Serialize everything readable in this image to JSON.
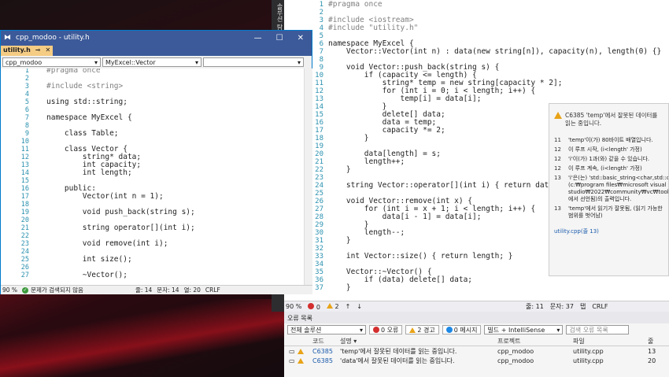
{
  "back_editor": {
    "side_tab": "솔루션 탐색기",
    "lines": [
      {
        "n": "1",
        "t": "#pragma once"
      },
      {
        "n": "2",
        "t": ""
      },
      {
        "n": "3",
        "t": "#include <iostream>"
      },
      {
        "n": "4",
        "t": "#include \"utility.h\""
      },
      {
        "n": "5",
        "t": ""
      },
      {
        "n": "6",
        "t": "namespace MyExcel {"
      },
      {
        "n": "7",
        "t": "    Vector::Vector(int n) : data(new string[n]), capacity(n), length(0) {}"
      },
      {
        "n": "8",
        "t": ""
      },
      {
        "n": "9",
        "t": "    void Vector::push_back(string s) {"
      },
      {
        "n": "10",
        "t": "        if (capacity <= length) {"
      },
      {
        "n": "11",
        "t": "            string* temp = new string[capacity * 2];"
      },
      {
        "n": "12",
        "t": "            for (int i = 0; i < length; i++) {"
      },
      {
        "n": "13",
        "t": "                temp[i] = data[i];"
      },
      {
        "n": "14",
        "t": "            }"
      },
      {
        "n": "15",
        "t": "            delete[] data;"
      },
      {
        "n": "16",
        "t": "            data = temp;"
      },
      {
        "n": "17",
        "t": "            capacity *= 2;"
      },
      {
        "n": "18",
        "t": "        }"
      },
      {
        "n": "19",
        "t": ""
      },
      {
        "n": "20",
        "t": "        data[length] = s;"
      },
      {
        "n": "21",
        "t": "        length++;"
      },
      {
        "n": "22",
        "t": "    }"
      },
      {
        "n": "23",
        "t": ""
      },
      {
        "n": "24",
        "t": "    string Vector::operator[](int i) { return data[i]; }"
      },
      {
        "n": "25",
        "t": ""
      },
      {
        "n": "26",
        "t": "    void Vector::remove(int x) {"
      },
      {
        "n": "27",
        "t": "        for (int i = x + 1; i < length; i++) {"
      },
      {
        "n": "28",
        "t": "            data[i - 1] = data[i];"
      },
      {
        "n": "29",
        "t": "        }"
      },
      {
        "n": "30",
        "t": "        length--;"
      },
      {
        "n": "31",
        "t": "    }"
      },
      {
        "n": "32",
        "t": ""
      },
      {
        "n": "33",
        "t": "    int Vector::size() { return length; }"
      },
      {
        "n": "34",
        "t": ""
      },
      {
        "n": "35",
        "t": "    Vector::~Vector() {"
      },
      {
        "n": "36",
        "t": "        if (data) delete[] data;"
      },
      {
        "n": "37",
        "t": "    }"
      }
    ],
    "status": {
      "zoom": "90 %",
      "errors": "0",
      "warnings": "2",
      "line": "줄: 11",
      "col": "문자: 37",
      "ws": "탭",
      "eol": "CRLF"
    }
  },
  "tooltip": {
    "header": "C6385 'temp'에서 잘못된 데이터를 읽는 중입니다.",
    "steps": [
      {
        "n": "11",
        "t": "'temp'이(가) 80바이트 배열입니다."
      },
      {
        "n": "12",
        "t": "이 루프 시작, (i<length' 가정)"
      },
      {
        "n": "12",
        "t": "'i'이(가) 1과(와) 같을 수 있습니다."
      },
      {
        "n": "12",
        "t": "이 루프 계속, (i<length' 가정)"
      },
      {
        "n": "13",
        "t": "'i'은(는) 'std::basic_string<char,std::char_traits<char>,std::allocator<char> >::=' (c:₩program files₩microsoft visual studio₩2022₩community₩vc₩tools₩msvc₩14.34.31933₩include₩xstring:3305에서 선언됨)의 출력입니다."
      },
      {
        "n": "13",
        "t": "'temp'에서 읽기가 잘못됨, (읽기 가능한 범위를 벗어남)"
      }
    ],
    "link": "utility.cpp(줄 13)"
  },
  "error_list": {
    "title": "오류 목록",
    "scope": "전체 솔루션",
    "errors_btn": "0 오류",
    "warnings_btn": "2 경고",
    "messages_btn": "0 메시지",
    "build_filter": "빌드 + IntelliSense",
    "search_placeholder": "검색 오류 목록",
    "headers": {
      "code": "코드",
      "desc": "설명",
      "project": "프로젝트",
      "file": "파일",
      "line": "줄"
    },
    "rows": [
      {
        "code": "C6385",
        "desc": "'temp'에서 잘못된 데이터를 읽는 중입니다.",
        "project": "cpp_modoo",
        "file": "utility.cpp",
        "line": "13"
      },
      {
        "code": "C6385",
        "desc": "'data'에서 잘못된 데이터를 읽는 중입니다.",
        "project": "cpp_modoo",
        "file": "utility.cpp",
        "line": "20"
      }
    ]
  },
  "front_window": {
    "title": "cpp_modoo - utility.h",
    "tab": "utility.h",
    "project_dd": "cpp_modoo",
    "scope_dd": "MyExcel::Vector",
    "lines": [
      {
        "n": "1",
        "t": "#pragma once"
      },
      {
        "n": "2",
        "t": ""
      },
      {
        "n": "3",
        "t": "#include <string>"
      },
      {
        "n": "4",
        "t": ""
      },
      {
        "n": "5",
        "t": "using std::string;"
      },
      {
        "n": "6",
        "t": ""
      },
      {
        "n": "7",
        "t": "namespace MyExcel {"
      },
      {
        "n": "8",
        "t": ""
      },
      {
        "n": "9",
        "t": "    class Table;"
      },
      {
        "n": "10",
        "t": ""
      },
      {
        "n": "11",
        "t": "    class Vector {"
      },
      {
        "n": "12",
        "t": "        string* data;"
      },
      {
        "n": "13",
        "t": "        int capacity;"
      },
      {
        "n": "14",
        "t": "        int length;"
      },
      {
        "n": "15",
        "t": ""
      },
      {
        "n": "16",
        "t": "    public:"
      },
      {
        "n": "17",
        "t": "        Vector(int n = 1);"
      },
      {
        "n": "18",
        "t": ""
      },
      {
        "n": "19",
        "t": "        void push_back(string s);"
      },
      {
        "n": "20",
        "t": ""
      },
      {
        "n": "21",
        "t": "        string operator[](int i);"
      },
      {
        "n": "22",
        "t": ""
      },
      {
        "n": "23",
        "t": "        void remove(int i);"
      },
      {
        "n": "24",
        "t": ""
      },
      {
        "n": "25",
        "t": "        int size();"
      },
      {
        "n": "26",
        "t": ""
      },
      {
        "n": "27",
        "t": "        ~Vector();"
      }
    ],
    "status": {
      "zoom": "90 %",
      "issues": "문제가 검색되지 않음",
      "line": "줄: 14",
      "col": "문자: 14",
      "pos": "열: 20",
      "eol": "CRLF"
    }
  }
}
